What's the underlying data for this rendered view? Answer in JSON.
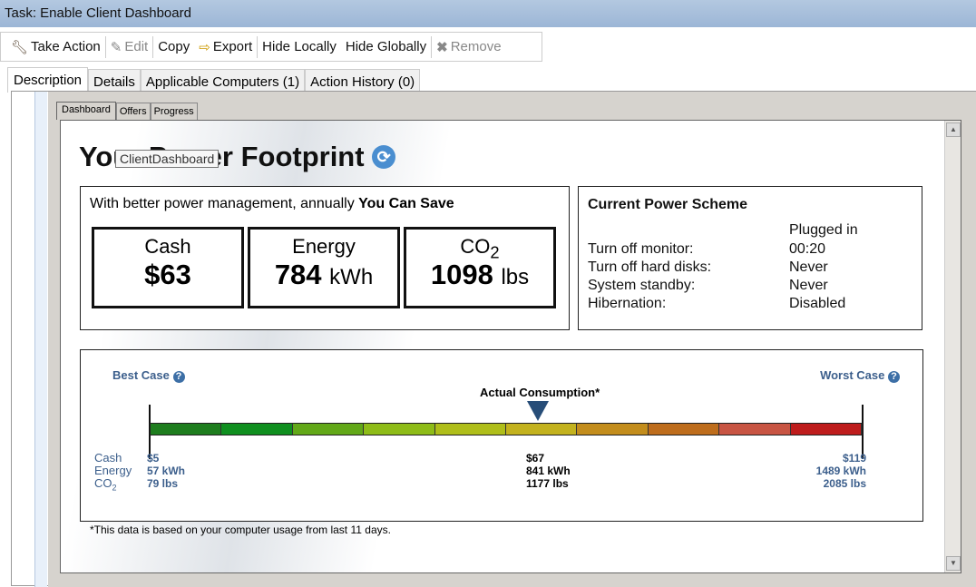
{
  "window": {
    "title": "Task: Enable Client Dashboard"
  },
  "toolbar": {
    "take_action": "Take Action",
    "edit": "Edit",
    "copy": "Copy",
    "export": "Export",
    "hide_locally": "Hide Locally",
    "hide_globally": "Hide Globally",
    "remove": "Remove"
  },
  "tabs": [
    "Description",
    "Details",
    "Applicable Computers (1)",
    "Action History (0)"
  ],
  "subtabs": [
    "Dashboard",
    "Offers",
    "Progress"
  ],
  "dashboard": {
    "title": "Your Power Footprint",
    "tooltip": "ClientDashboard",
    "save_intro": "With better power management, annually ",
    "save_bold": "You Can Save",
    "cash": {
      "label": "Cash",
      "value": "$63"
    },
    "energy": {
      "label": "Energy",
      "value": "784",
      "unit": "kWh"
    },
    "co2": {
      "label": "CO",
      "sub": "2",
      "value": "1098",
      "unit": "lbs"
    },
    "scheme": {
      "title": "Current Power Scheme",
      "column": "Plugged in",
      "rows": [
        {
          "k": "Turn off monitor:",
          "v": "00:20"
        },
        {
          "k": "Turn off hard disks:",
          "v": "Never"
        },
        {
          "k": "System standby:",
          "v": "Never"
        },
        {
          "k": "Hibernation:",
          "v": "Disabled"
        }
      ]
    },
    "best_case": "Best Case",
    "worst_case": "Worst Case",
    "actual": "Actual Consumption*",
    "row_labels": {
      "cash": "Cash",
      "energy": "Energy",
      "co2": "CO",
      "co2_sub": "2"
    },
    "best": {
      "cash": "$5",
      "energy": "57 kWh",
      "co2": "79 lbs"
    },
    "actual_vals": {
      "cash": "$67",
      "energy": "841 kWh",
      "co2": "1177 lbs"
    },
    "worst": {
      "cash": "$119",
      "energy": "1489 kWh",
      "co2": "2085 lbs"
    },
    "actual_position": 0.545,
    "segment_colors": [
      "#1e7d1e",
      "#0f8f1f",
      "#62a818",
      "#8ebc18",
      "#afbe1a",
      "#c3b21e",
      "#c38d1c",
      "#be6d1c",
      "#c85543",
      "#be1c1c"
    ],
    "footnote": "*This data is based on your computer usage from last 11 days."
  }
}
